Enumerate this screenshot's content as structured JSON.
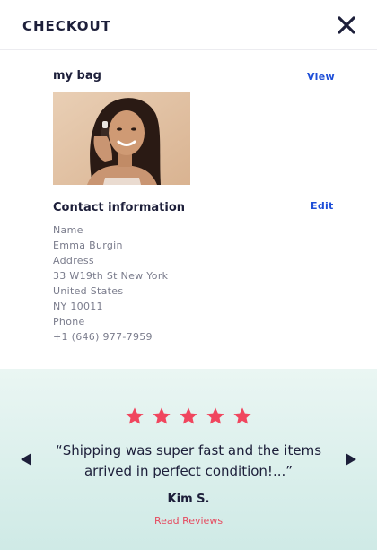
{
  "header": {
    "title": "CHECKOUT",
    "close_icon": "close-icon"
  },
  "bag": {
    "title": "my bag",
    "view_label": "View",
    "product_image": "woman-holding-serum-bottle"
  },
  "contact": {
    "title": "Contact information",
    "edit_label": "Edit",
    "lines": [
      "Name",
      "Emma Burgin",
      "Address",
      "33 W19th St New York",
      "United States",
      "NY 10011",
      "Phone",
      "+1 (646) 977-7959"
    ]
  },
  "review": {
    "rating": 5,
    "max_rating": 5,
    "quote": "“Shipping was super fast and the items arrived in perfect condition!...”",
    "reviewer": "Kim S.",
    "read_reviews_label": "Read Reviews",
    "prev_icon": "caret-left-icon",
    "next_icon": "caret-right-icon"
  },
  "colors": {
    "text_dark": "#1d1f3a",
    "text_muted": "#7a7c8c",
    "link_blue": "#1d4ed8",
    "star_pink": "#f0465e",
    "review_bg_top": "#eaf6f3",
    "review_bg_bottom": "#cfeae6"
  }
}
